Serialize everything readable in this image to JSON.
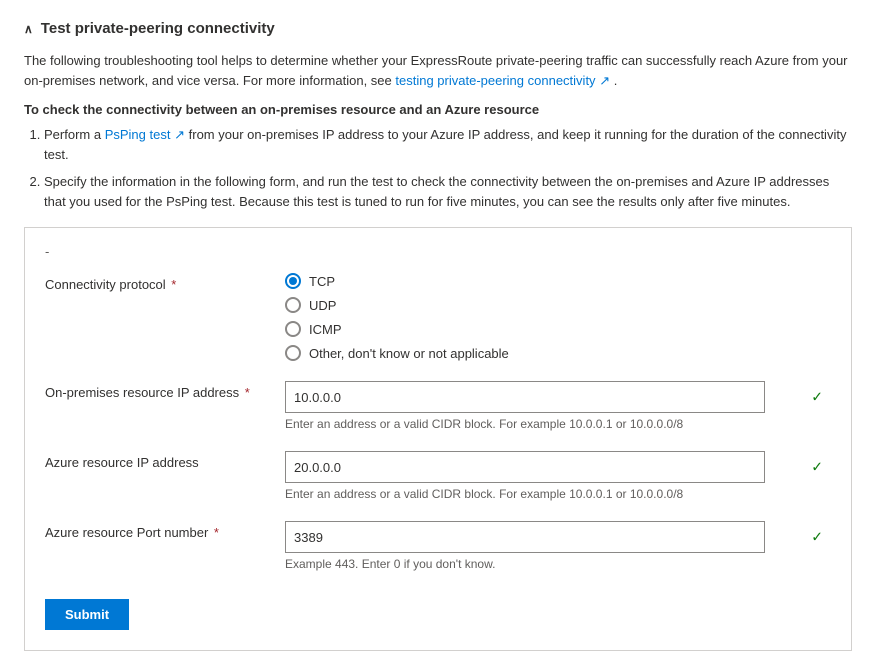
{
  "page": {
    "section_title": "Test private-peering connectivity",
    "description1": "The following troubleshooting tool helps to determine whether your ExpressRoute private-peering traffic can successfully reach Azure from your on-premises network, and vice versa. For more information, see",
    "link_text": "testing private-peering connectivity",
    "description1_end": ".",
    "bold_header": "To check the connectivity between an on-premises resource and an Azure resource",
    "step1_part1": "Perform a",
    "step1_link1": "PsPing test",
    "step1_part2": "from your on-premises IP address to your Azure IP address, and keep it running for the duration of the connectivity test.",
    "step2": "Specify the information in the following form, and run the test to check the connectivity between the on-premises and Azure IP addresses that you used for the PsPing test. Because this test is tuned to run for five minutes, you can see the results only after five minutes.",
    "dash": "-",
    "form": {
      "connectivity_protocol_label": "Connectivity protocol",
      "protocol_options": [
        "TCP",
        "UDP",
        "ICMP",
        "Other, don't know or not applicable"
      ],
      "protocol_selected": "TCP",
      "on_premises_label": "On-premises resource IP address",
      "on_premises_value": "10.0.0.0",
      "on_premises_hint": "Enter an address or a valid CIDR block. For example 10.0.0.1 or 10.0.0.0/8",
      "azure_ip_label": "Azure resource IP address",
      "azure_ip_value": "20.0.0.0",
      "azure_ip_hint": "Enter an address or a valid CIDR block. For example 10.0.0.1 or 10.0.0.0/8",
      "port_label": "Azure resource Port number",
      "port_value": "3389",
      "port_hint": "Example 443. Enter 0 if you don't know.",
      "submit_label": "Submit"
    }
  }
}
